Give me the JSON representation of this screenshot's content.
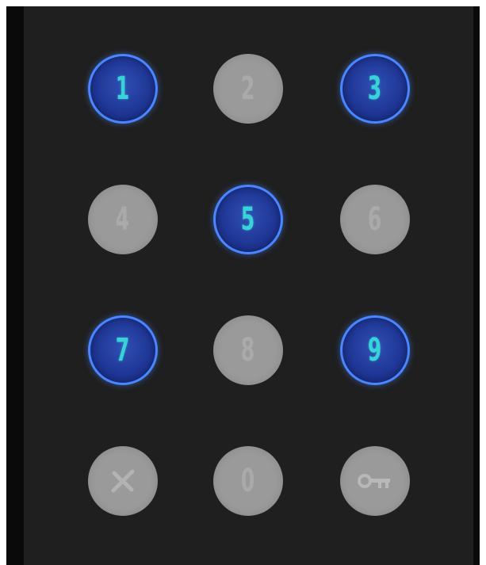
{
  "keypad": {
    "keys": [
      {
        "label": "1",
        "lit": true
      },
      {
        "label": "2",
        "lit": false
      },
      {
        "label": "3",
        "lit": true
      },
      {
        "label": "4",
        "lit": false
      },
      {
        "label": "5",
        "lit": true
      },
      {
        "label": "6",
        "lit": false
      },
      {
        "label": "7",
        "lit": true
      },
      {
        "label": "8",
        "lit": false
      },
      {
        "label": "9",
        "lit": true
      },
      {
        "label": "",
        "icon": "cancel-x-icon",
        "lit": false
      },
      {
        "label": "0",
        "lit": false
      },
      {
        "label": "",
        "icon": "key-icon",
        "lit": false
      }
    ]
  },
  "colors": {
    "background": "#1f1f1f",
    "key_off": "#9a9a9a",
    "key_on_fill": "#1e3594",
    "key_on_ring": "#4a86ff",
    "digit_on": "#38d3d7"
  }
}
